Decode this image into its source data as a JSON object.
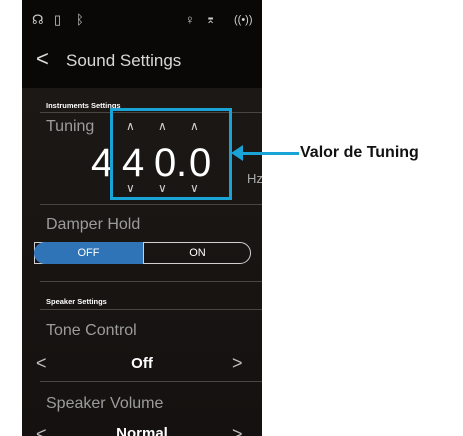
{
  "status_bar": {
    "headphones_icon": "headphones-icon",
    "usb_icon": "usb-icon",
    "bluetooth_icon": "bluetooth-icon",
    "mic_icon": "microphone-icon",
    "midi_icon": "midi-icon",
    "wireless_icon": "wireless-icon"
  },
  "header": {
    "back": "<",
    "title": "Sound Settings"
  },
  "instruments": {
    "section_label": "Instruments Settings",
    "tuning_label": "Tuning",
    "digits": [
      "4",
      "4",
      "0",
      ".",
      "0"
    ],
    "unit": "Hz",
    "damper_label": "Damper Hold",
    "damper_off": "OFF",
    "damper_on": "ON",
    "damper_state": "OFF"
  },
  "speaker": {
    "section_label": "Speaker Settings",
    "tone_label": "Tone Control",
    "tone_value": "Off",
    "volume_label": "Speaker Volume",
    "volume_value": "Normal",
    "prev": "<",
    "next": ">"
  },
  "callout": {
    "text": "Valor de Tuning"
  },
  "colors": {
    "accent": "#19a3d6",
    "toggle_on": "#2f74b7",
    "background": "#090807"
  }
}
